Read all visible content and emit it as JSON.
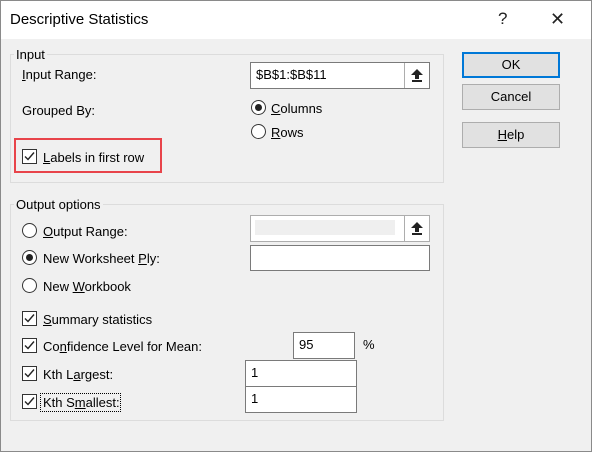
{
  "dialog": {
    "title": "Descriptive Statistics",
    "help_glyph": "?",
    "close_glyph": "✕"
  },
  "input_group": {
    "legend": "Input",
    "input_range_label_u": "I",
    "input_range_label_rest": "nput Range:",
    "input_range_value": "$B$1:$B$11",
    "grouped_by_label": "Grouped By:",
    "columns_u": "C",
    "columns_rest": "olumns",
    "columns_checked": true,
    "rows_u": "R",
    "rows_rest": "ows",
    "rows_checked": false,
    "labels_u": "L",
    "labels_rest": "abels in first row",
    "labels_checked": true
  },
  "output_group": {
    "legend": "Output options",
    "output_range_u": "O",
    "output_range_rest": "utput Range:",
    "output_range_checked": false,
    "output_range_value": "",
    "new_ply_pre": "New Worksheet ",
    "new_ply_u": "P",
    "new_ply_rest": "ly:",
    "new_ply_checked": true,
    "new_ply_value": "",
    "new_wb_pre": "New ",
    "new_wb_u": "W",
    "new_wb_rest": "orkbook",
    "new_wb_checked": false,
    "summary_u": "S",
    "summary_rest": "ummary statistics",
    "summary_checked": true,
    "confidence_pre": "Co",
    "confidence_u": "n",
    "confidence_rest": "fidence Level for Mean:",
    "confidence_checked": true,
    "confidence_value": "95",
    "confidence_unit": "%",
    "kth_largest_pre": "Kth L",
    "kth_largest_u": "a",
    "kth_largest_rest": "rgest:",
    "kth_largest_checked": true,
    "kth_largest_value": "1",
    "kth_smallest_pre": "Kth S",
    "kth_smallest_u": "m",
    "kth_smallest_rest": "allest:",
    "kth_smallest_checked": true,
    "kth_smallest_value": "1"
  },
  "buttons": {
    "ok": "OK",
    "cancel": "Cancel",
    "help_u": "H",
    "help_rest": "elp"
  },
  "colors": {
    "highlight": "#e8444a",
    "default_button_border": "#0078d7"
  }
}
